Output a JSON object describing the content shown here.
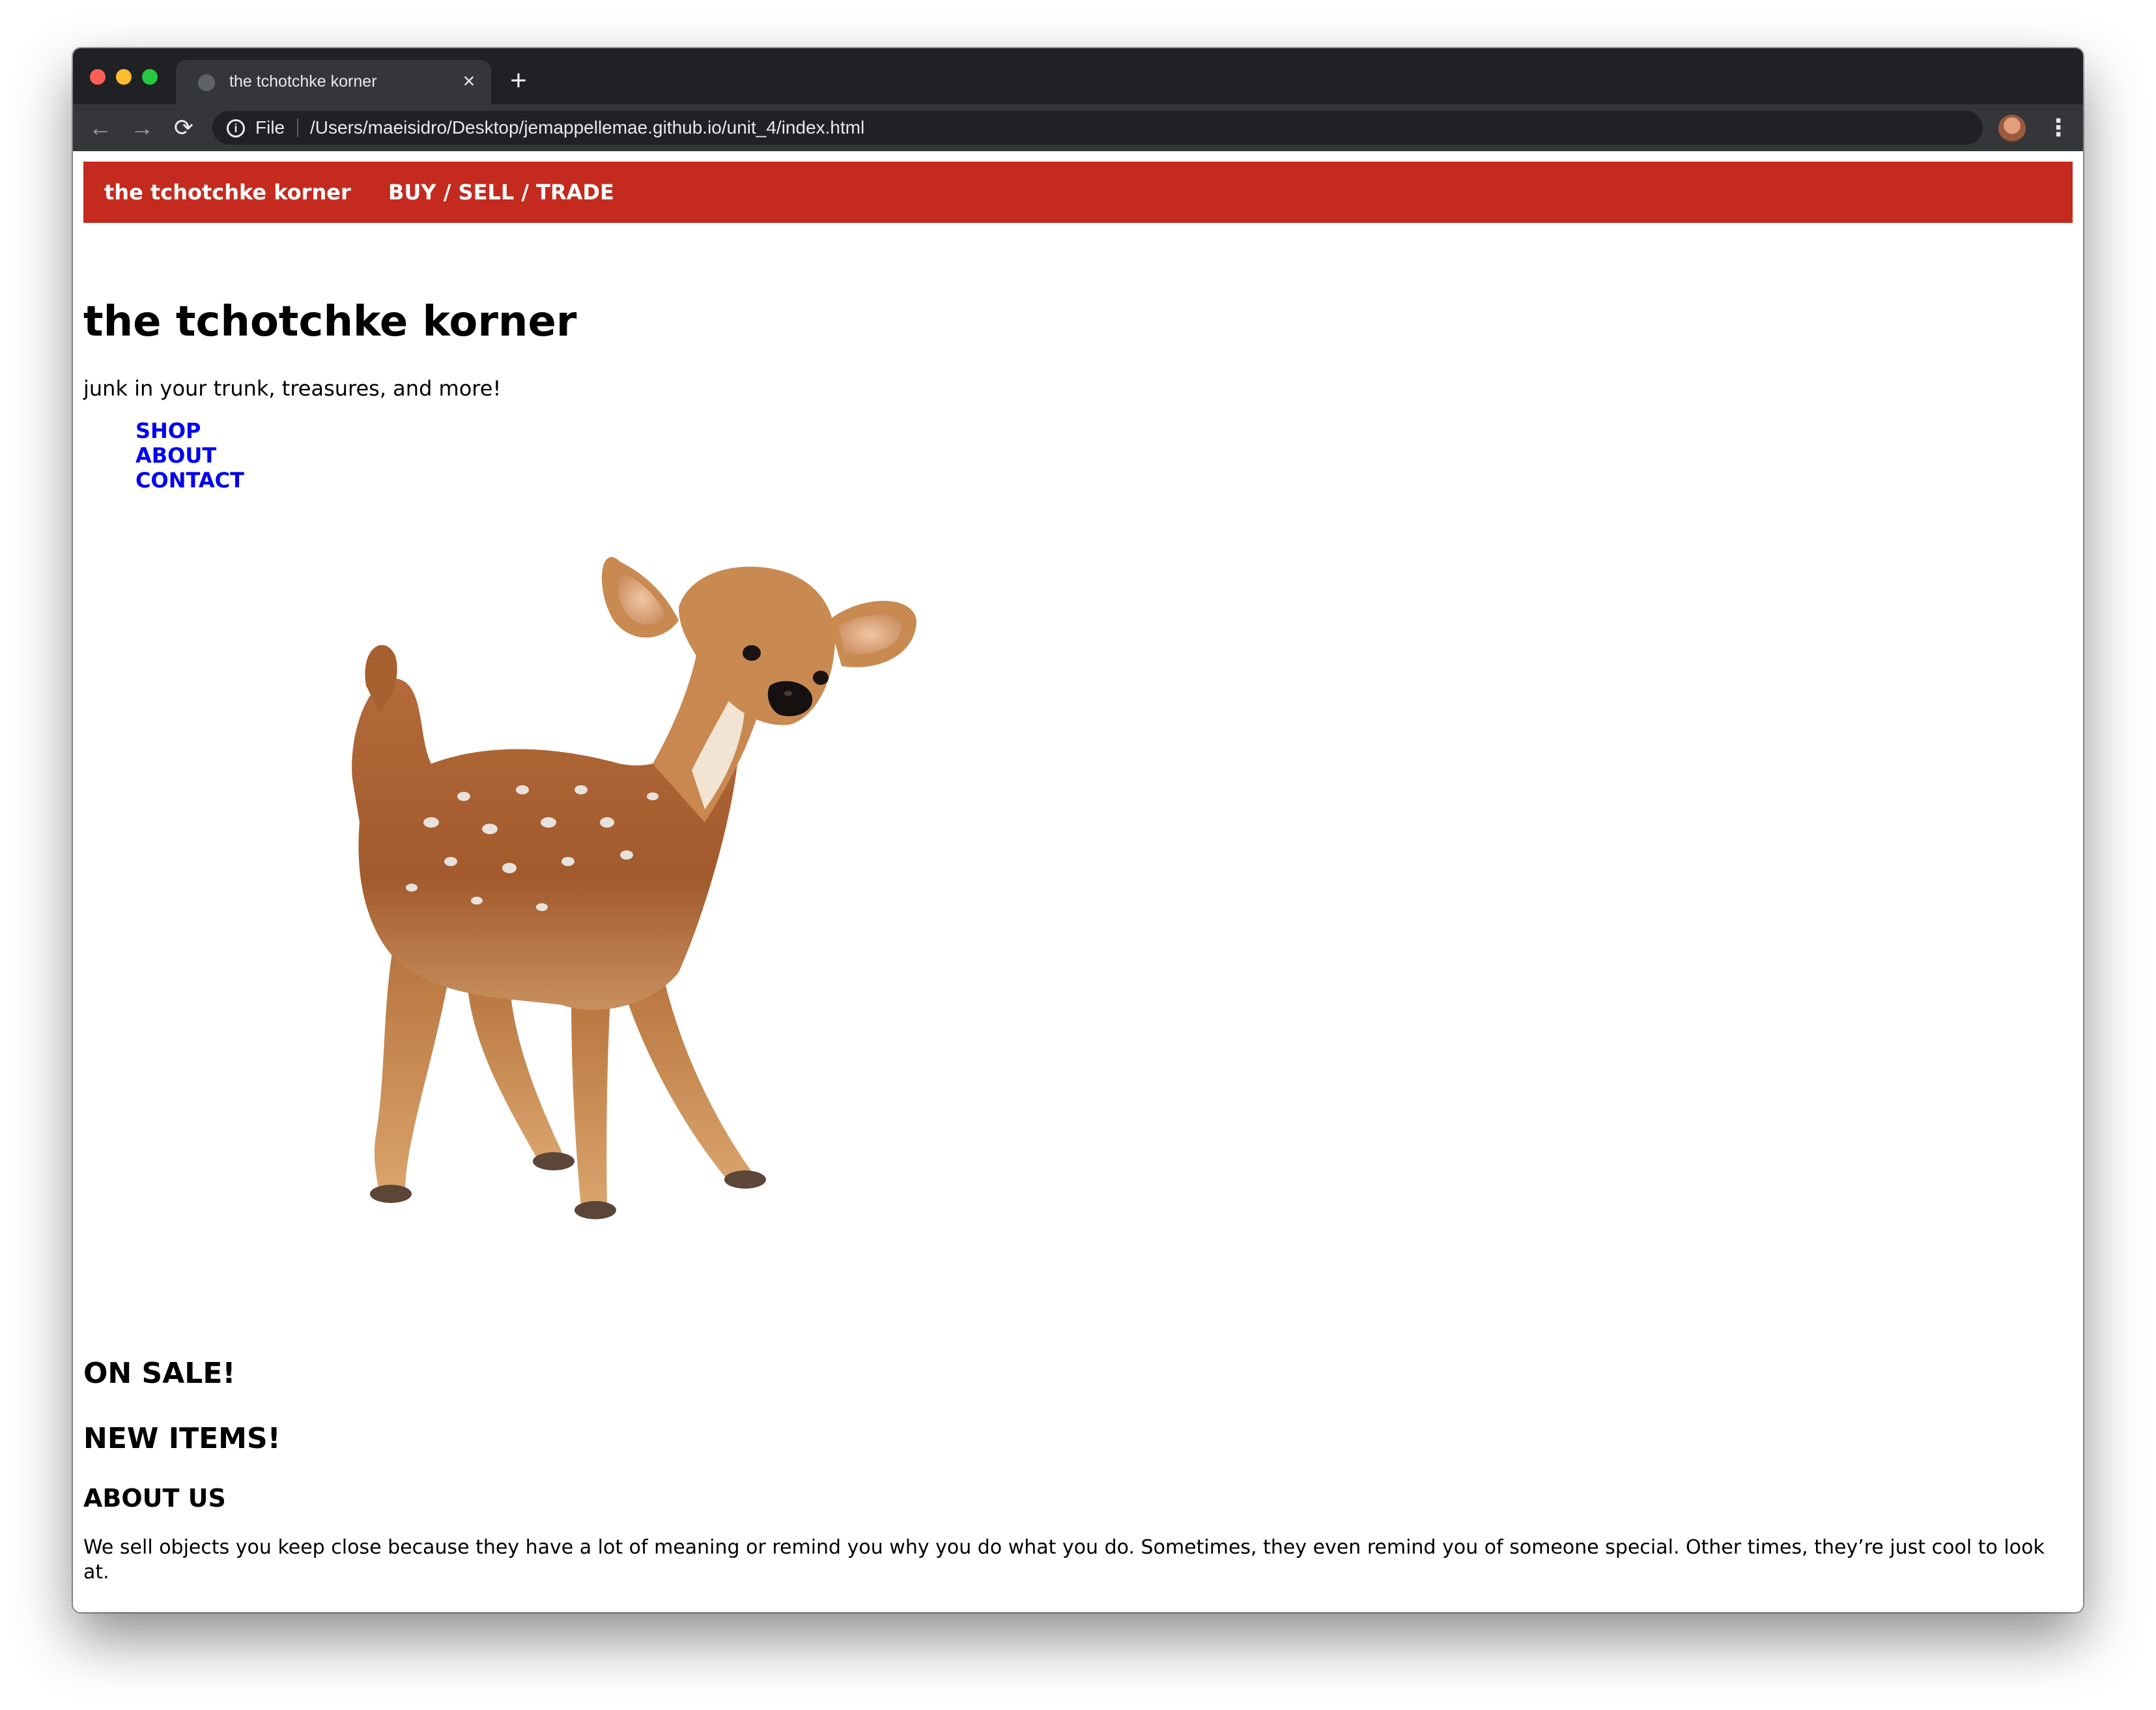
{
  "browser": {
    "tab_title": "the tchotchke korner",
    "tab_close_glyph": "×",
    "new_tab_glyph": "+",
    "back_glyph": "←",
    "forward_glyph": "→",
    "reload_glyph": "⟳",
    "info_glyph": "i",
    "scheme_label": "File",
    "url": "/Users/maeisidro/Desktop/jemappellemae.github.io/unit_4/index.html",
    "star_glyph": "☆",
    "menu_glyph": "⋮",
    "icons": {
      "favicon": "globe-icon",
      "info": "info-icon",
      "bookmark": "star-icon",
      "menu": "kebab-menu-icon"
    }
  },
  "topbar": {
    "brand": "the tchotchke korner",
    "link": "BUY / SELL / TRADE",
    "background": "#c42a1e"
  },
  "page": {
    "title": "the tchotchke korner",
    "tagline": "junk in your trunk, treasures, and more!",
    "nav": [
      {
        "label": "SHOP"
      },
      {
        "label": "ABOUT"
      },
      {
        "label": "CONTACT"
      }
    ],
    "link_color": "#0000ee",
    "sections": {
      "sale": "ON SALE!",
      "new_items": "NEW ITEMS!",
      "about": "ABOUT US"
    },
    "about_text": "We sell objects you keep close because they have a lot of meaning or remind you why you do what you do. Sometimes, they even remind you of someone special. Other times, they’re just cool to look at."
  }
}
